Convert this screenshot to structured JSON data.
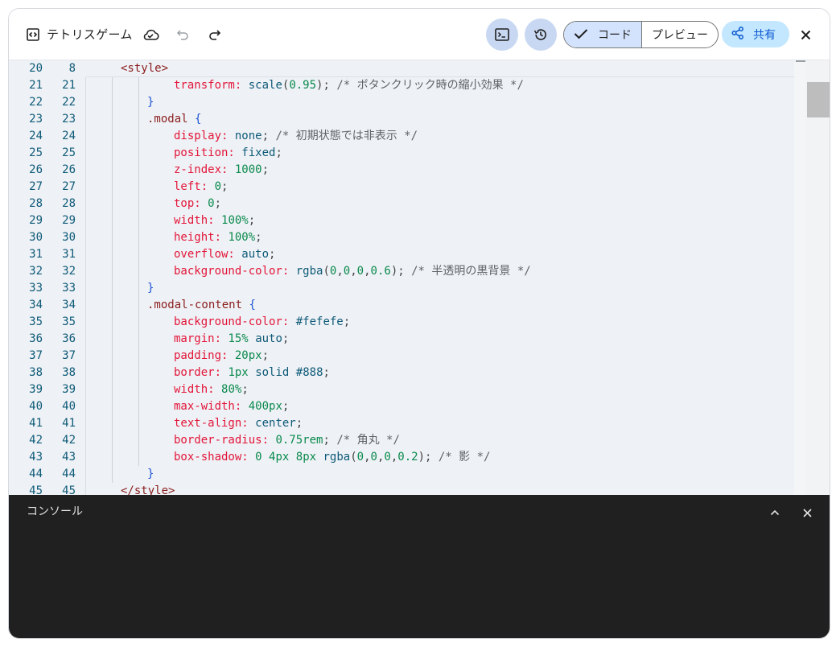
{
  "app": {
    "title": "テトリスゲーム"
  },
  "toolbar": {
    "code_label": "コード",
    "preview_label": "プレビュー",
    "share_label": "共有"
  },
  "editor": {
    "sticky": {
      "old": "20",
      "new": "8",
      "text": "<style>"
    },
    "lines": [
      {
        "old": "21",
        "new": "21",
        "indent": 2,
        "tokens": [
          [
            "prop",
            "transform:"
          ],
          [
            "punc",
            " "
          ],
          [
            "val",
            "scale"
          ],
          [
            "punc",
            "("
          ],
          [
            "num",
            "0.95"
          ],
          [
            "punc",
            ");"
          ],
          [
            "punc",
            " "
          ],
          [
            "com",
            "/* ボタンクリック時の縮小効果 */"
          ]
        ]
      },
      {
        "old": "22",
        "new": "22",
        "indent": 1,
        "tokens": [
          [
            "brace",
            "}"
          ]
        ]
      },
      {
        "old": "23",
        "new": "23",
        "indent": 1,
        "tokens": [
          [
            "sel",
            ".modal"
          ],
          [
            "punc",
            " "
          ],
          [
            "brace",
            "{"
          ]
        ]
      },
      {
        "old": "24",
        "new": "24",
        "indent": 2,
        "tokens": [
          [
            "prop",
            "display:"
          ],
          [
            "punc",
            " "
          ],
          [
            "val",
            "none"
          ],
          [
            "punc",
            ";"
          ],
          [
            "punc",
            " "
          ],
          [
            "com",
            "/* 初期状態では非表示 */"
          ]
        ]
      },
      {
        "old": "25",
        "new": "25",
        "indent": 2,
        "tokens": [
          [
            "prop",
            "position:"
          ],
          [
            "punc",
            " "
          ],
          [
            "val",
            "fixed"
          ],
          [
            "punc",
            ";"
          ]
        ]
      },
      {
        "old": "26",
        "new": "26",
        "indent": 2,
        "tokens": [
          [
            "prop",
            "z-index:"
          ],
          [
            "punc",
            " "
          ],
          [
            "num",
            "1000"
          ],
          [
            "punc",
            ";"
          ]
        ]
      },
      {
        "old": "27",
        "new": "27",
        "indent": 2,
        "tokens": [
          [
            "prop",
            "left:"
          ],
          [
            "punc",
            " "
          ],
          [
            "num",
            "0"
          ],
          [
            "punc",
            ";"
          ]
        ]
      },
      {
        "old": "28",
        "new": "28",
        "indent": 2,
        "tokens": [
          [
            "prop",
            "top:"
          ],
          [
            "punc",
            " "
          ],
          [
            "num",
            "0"
          ],
          [
            "punc",
            ";"
          ]
        ]
      },
      {
        "old": "29",
        "new": "29",
        "indent": 2,
        "tokens": [
          [
            "prop",
            "width:"
          ],
          [
            "punc",
            " "
          ],
          [
            "num",
            "100%"
          ],
          [
            "punc",
            ";"
          ]
        ]
      },
      {
        "old": "30",
        "new": "30",
        "indent": 2,
        "tokens": [
          [
            "prop",
            "height:"
          ],
          [
            "punc",
            " "
          ],
          [
            "num",
            "100%"
          ],
          [
            "punc",
            ";"
          ]
        ]
      },
      {
        "old": "31",
        "new": "31",
        "indent": 2,
        "tokens": [
          [
            "prop",
            "overflow:"
          ],
          [
            "punc",
            " "
          ],
          [
            "val",
            "auto"
          ],
          [
            "punc",
            ";"
          ]
        ]
      },
      {
        "old": "32",
        "new": "32",
        "indent": 2,
        "tokens": [
          [
            "prop",
            "background-color:"
          ],
          [
            "punc",
            " "
          ],
          [
            "fn",
            "rgba"
          ],
          [
            "punc",
            "("
          ],
          [
            "num",
            "0"
          ],
          [
            "punc",
            ","
          ],
          [
            "num",
            "0"
          ],
          [
            "punc",
            ","
          ],
          [
            "num",
            "0"
          ],
          [
            "punc",
            ","
          ],
          [
            "num",
            "0.6"
          ],
          [
            "punc",
            ");"
          ],
          [
            "punc",
            " "
          ],
          [
            "com",
            "/* 半透明の黒背景 */"
          ]
        ]
      },
      {
        "old": "33",
        "new": "33",
        "indent": 1,
        "tokens": [
          [
            "brace",
            "}"
          ]
        ]
      },
      {
        "old": "34",
        "new": "34",
        "indent": 1,
        "tokens": [
          [
            "sel",
            ".modal-content"
          ],
          [
            "punc",
            " "
          ],
          [
            "brace",
            "{"
          ]
        ]
      },
      {
        "old": "35",
        "new": "35",
        "indent": 2,
        "tokens": [
          [
            "prop",
            "background-color:"
          ],
          [
            "punc",
            " "
          ],
          [
            "hex",
            "#fefefe"
          ],
          [
            "punc",
            ";"
          ]
        ]
      },
      {
        "old": "36",
        "new": "36",
        "indent": 2,
        "tokens": [
          [
            "prop",
            "margin:"
          ],
          [
            "punc",
            " "
          ],
          [
            "num",
            "15%"
          ],
          [
            "punc",
            " "
          ],
          [
            "val",
            "auto"
          ],
          [
            "punc",
            ";"
          ]
        ]
      },
      {
        "old": "37",
        "new": "37",
        "indent": 2,
        "tokens": [
          [
            "prop",
            "padding:"
          ],
          [
            "punc",
            " "
          ],
          [
            "num",
            "20px"
          ],
          [
            "punc",
            ";"
          ]
        ]
      },
      {
        "old": "38",
        "new": "38",
        "indent": 2,
        "tokens": [
          [
            "prop",
            "border:"
          ],
          [
            "punc",
            " "
          ],
          [
            "num",
            "1px"
          ],
          [
            "punc",
            " "
          ],
          [
            "val",
            "solid"
          ],
          [
            "punc",
            " "
          ],
          [
            "hex",
            "#888"
          ],
          [
            "punc",
            ";"
          ]
        ]
      },
      {
        "old": "39",
        "new": "39",
        "indent": 2,
        "tokens": [
          [
            "prop",
            "width:"
          ],
          [
            "punc",
            " "
          ],
          [
            "num",
            "80%"
          ],
          [
            "punc",
            ";"
          ]
        ]
      },
      {
        "old": "40",
        "new": "40",
        "indent": 2,
        "tokens": [
          [
            "prop",
            "max-width:"
          ],
          [
            "punc",
            " "
          ],
          [
            "num",
            "400px"
          ],
          [
            "punc",
            ";"
          ]
        ]
      },
      {
        "old": "41",
        "new": "41",
        "indent": 2,
        "tokens": [
          [
            "prop",
            "text-align:"
          ],
          [
            "punc",
            " "
          ],
          [
            "val",
            "center"
          ],
          [
            "punc",
            ";"
          ]
        ]
      },
      {
        "old": "42",
        "new": "42",
        "indent": 2,
        "tokens": [
          [
            "prop",
            "border-radius:"
          ],
          [
            "punc",
            " "
          ],
          [
            "num",
            "0.75rem"
          ],
          [
            "punc",
            ";"
          ],
          [
            "punc",
            " "
          ],
          [
            "com",
            "/* 角丸 */"
          ]
        ]
      },
      {
        "old": "43",
        "new": "43",
        "indent": 2,
        "tokens": [
          [
            "prop",
            "box-shadow:"
          ],
          [
            "punc",
            " "
          ],
          [
            "num",
            "0"
          ],
          [
            "punc",
            " "
          ],
          [
            "num",
            "4px"
          ],
          [
            "punc",
            " "
          ],
          [
            "num",
            "8px"
          ],
          [
            "punc",
            " "
          ],
          [
            "fn",
            "rgba"
          ],
          [
            "punc",
            "("
          ],
          [
            "num",
            "0"
          ],
          [
            "punc",
            ","
          ],
          [
            "num",
            "0"
          ],
          [
            "punc",
            ","
          ],
          [
            "num",
            "0"
          ],
          [
            "punc",
            ","
          ],
          [
            "num",
            "0.2"
          ],
          [
            "punc",
            ");"
          ],
          [
            "punc",
            " "
          ],
          [
            "com",
            "/* 影 */"
          ]
        ]
      },
      {
        "old": "44",
        "new": "44",
        "indent": 1,
        "tokens": [
          [
            "brace",
            "}"
          ]
        ]
      },
      {
        "old": "45",
        "new": "45",
        "indent": 0,
        "tokens": [
          [
            "tag",
            "</style>"
          ]
        ]
      }
    ]
  },
  "console": {
    "title": "コンソール"
  },
  "colors": {
    "accent": "#0b57d0",
    "toggle_active": "#c8d8f2",
    "share_bg": "#c2e7ff",
    "editor_bg": "#eef1f5",
    "console_bg": "#202020"
  },
  "icons": [
    "code-file-icon",
    "cloud-icon",
    "undo-icon",
    "redo-icon",
    "terminal-icon",
    "history-icon",
    "check-icon",
    "share-icon",
    "close-icon",
    "chevron-up-icon"
  ]
}
